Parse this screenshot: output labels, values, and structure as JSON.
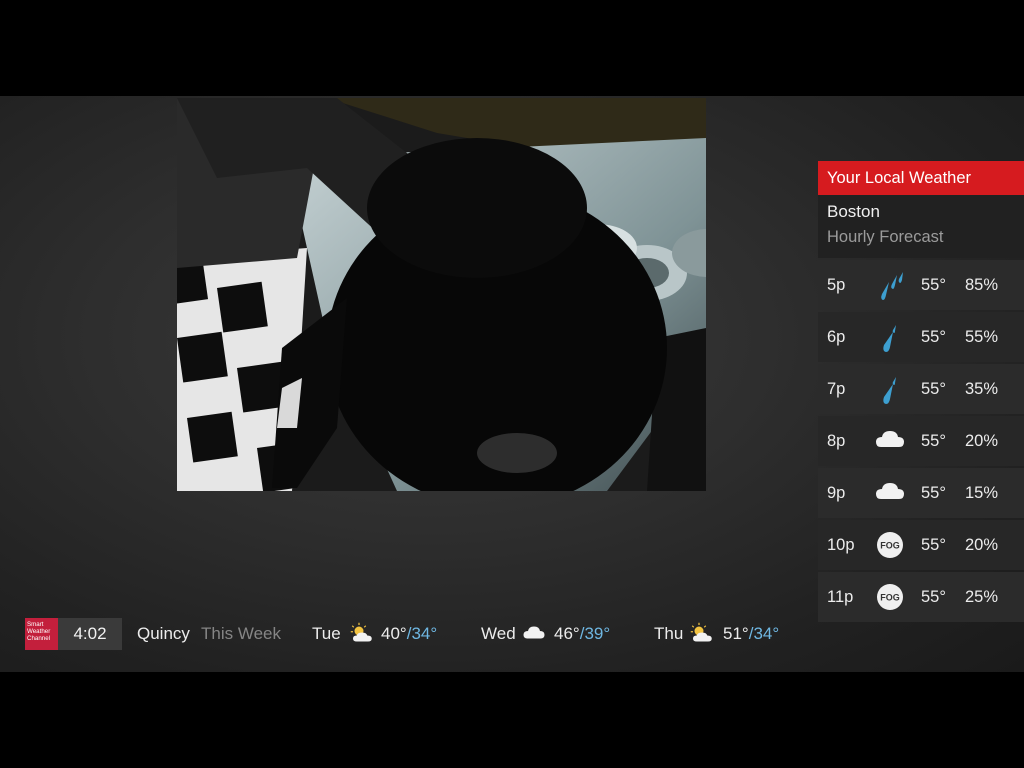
{
  "panel": {
    "header": "Your Local Weather",
    "city": "Boston",
    "subtitle": "Hourly Forecast",
    "hours": [
      {
        "time": "5p",
        "icon": "heavy-rain-icon",
        "temp": "55°",
        "pct": "85%"
      },
      {
        "time": "6p",
        "icon": "light-rain-icon",
        "temp": "55°",
        "pct": "55%"
      },
      {
        "time": "7p",
        "icon": "light-rain-icon",
        "temp": "55°",
        "pct": "35%"
      },
      {
        "time": "8p",
        "icon": "cloud-icon",
        "temp": "55°",
        "pct": "20%"
      },
      {
        "time": "9p",
        "icon": "cloud-icon",
        "temp": "55°",
        "pct": "15%"
      },
      {
        "time": "10p",
        "icon": "fog-icon",
        "temp": "55°",
        "pct": "20%"
      },
      {
        "time": "11p",
        "icon": "fog-icon",
        "temp": "55°",
        "pct": "25%"
      }
    ],
    "fog_label": "FOG"
  },
  "ticker": {
    "logo_lines": [
      "Smart",
      "Weather",
      "Channel"
    ],
    "time": "4:02",
    "city": "Quincy",
    "week_label": "This Week",
    "days": [
      {
        "day": "Tue",
        "icon": "partly-sunny-icon",
        "hi": "40°",
        "sep": "/",
        "lo": "34°"
      },
      {
        "day": "Wed",
        "icon": "cloud-icon",
        "hi": "46°",
        "sep": "/",
        "lo": "39°"
      },
      {
        "day": "Thu",
        "icon": "partly-sunny-icon",
        "hi": "51°",
        "sep": "/",
        "lo": "34°"
      }
    ]
  },
  "colors": {
    "accent": "#d61b1f",
    "logo": "#c31f3c",
    "low_temp": "#6fb7e2",
    "rain": "#3d9fd0"
  }
}
